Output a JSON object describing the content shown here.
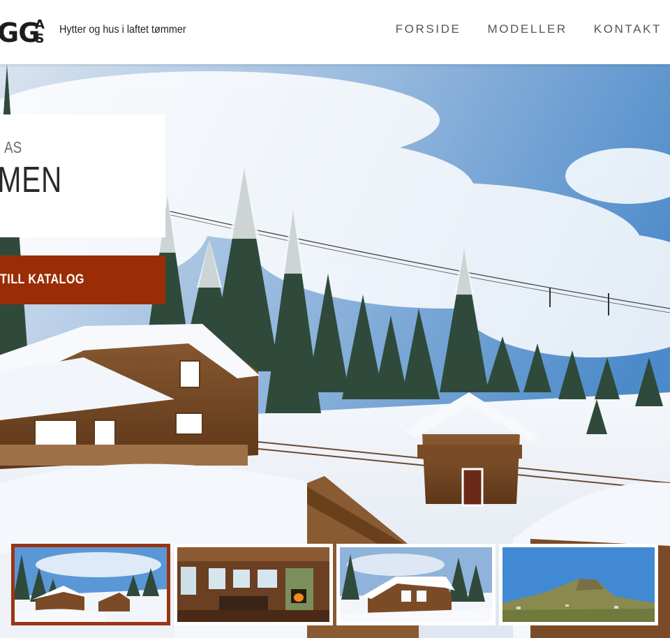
{
  "header": {
    "logo_text": "GG",
    "logo_suffix": [
      "A",
      "S"
    ],
    "tagline": "Hytter og hus i laftet tømmer",
    "nav": [
      {
        "label": "FORSIDE"
      },
      {
        "label": "MODELLER"
      },
      {
        "label": "KONTAKT"
      }
    ]
  },
  "hero": {
    "subtitle": "AS",
    "title": "MMEN",
    "cta_label": "TILL KATALOG"
  },
  "thumbnails": {
    "active_index": 0,
    "items": [
      {
        "name": "winter-cabins"
      },
      {
        "name": "cabin-interior"
      },
      {
        "name": "snowy-cabin"
      },
      {
        "name": "mountain-summer"
      }
    ]
  },
  "colors": {
    "accent": "#9a2d05",
    "active_border": "#9a3513",
    "nav_text": "#555555"
  }
}
